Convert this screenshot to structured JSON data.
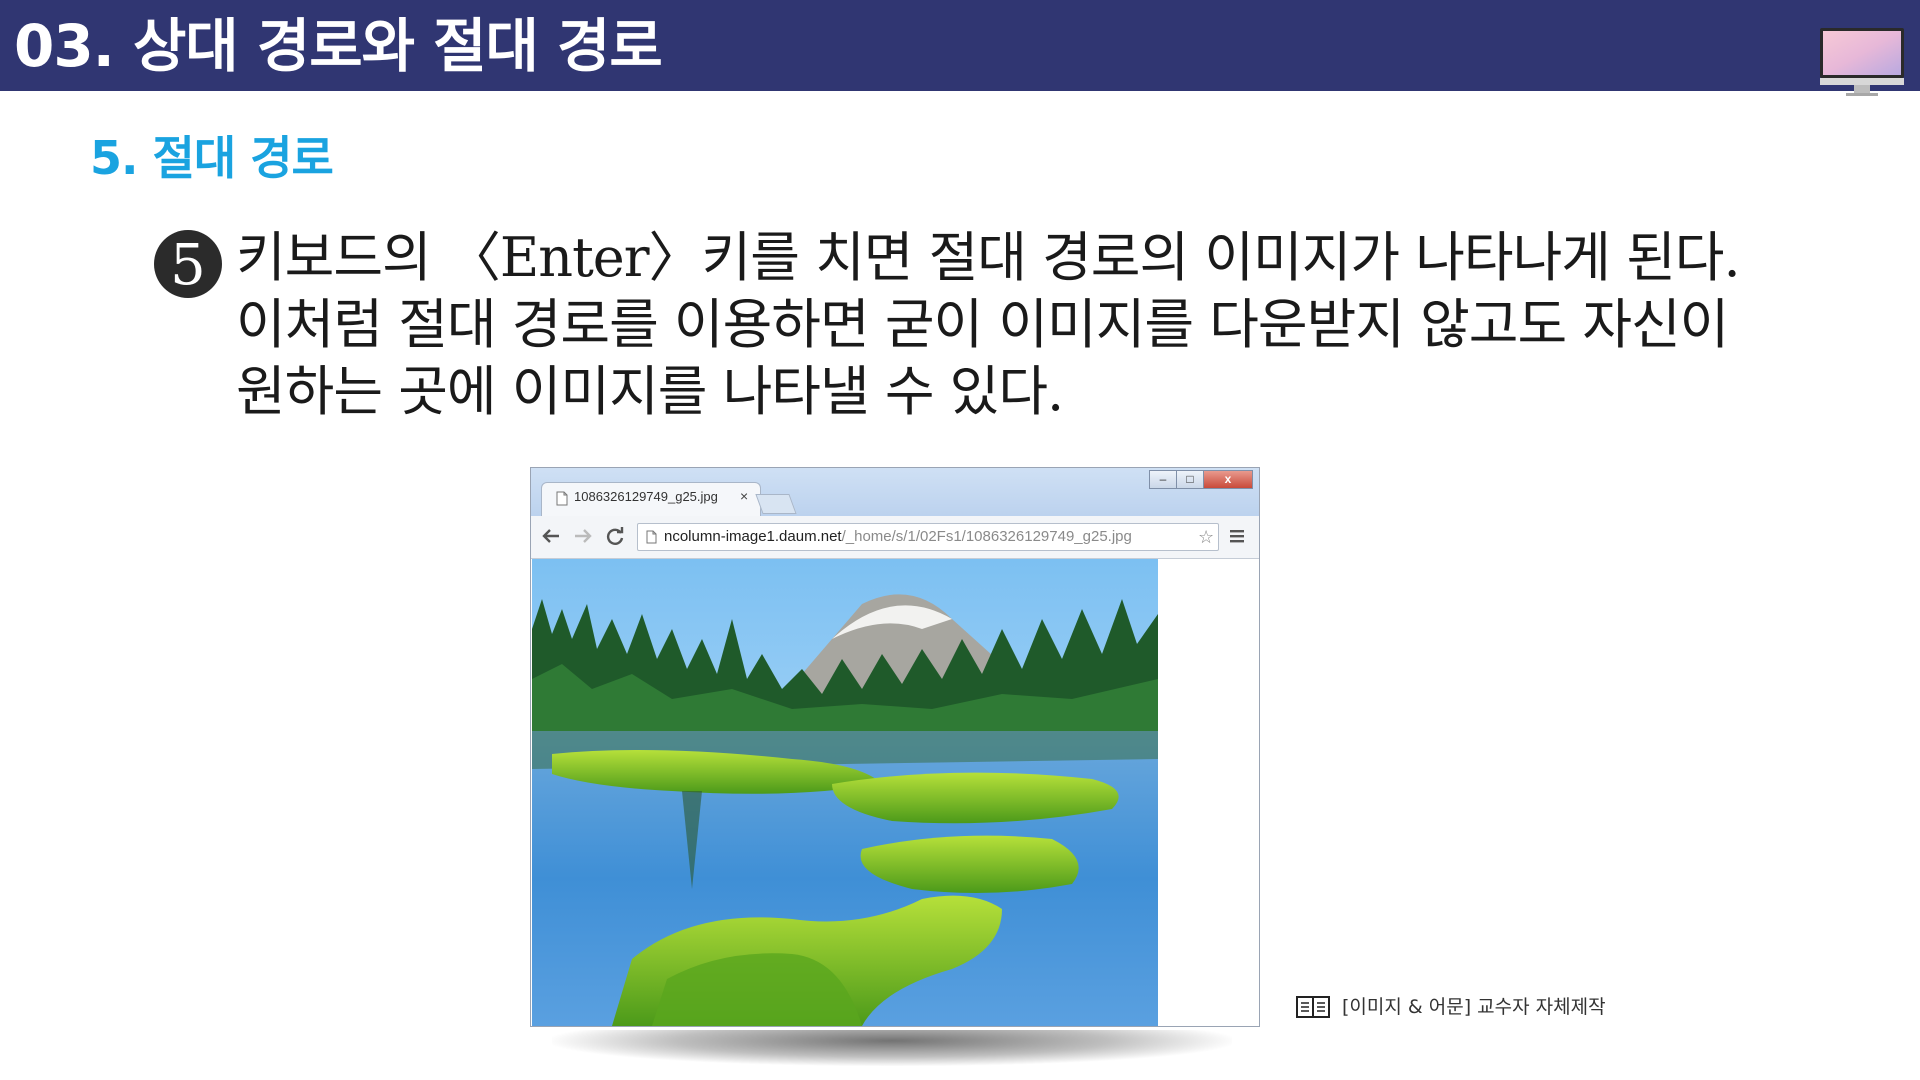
{
  "header": {
    "title": "03. 상대 경로와 절대 경로"
  },
  "section": {
    "heading": "5. 절대 경로"
  },
  "step": {
    "number": "5",
    "lines": [
      "키보드의 〈Enter〉키를 치면 절대 경로의 이미지가 나타나게 된다.",
      "이처럼 절대 경로를 이용하면 굳이 이미지를 다운받지 않고도 자신이",
      "원하는 곳에 이미지를 나타낼 수 있다."
    ]
  },
  "browser": {
    "tab_title": "1086326129749_g25.jpg",
    "tab_close": "×",
    "url_host": "ncolumn-image1.daum.net",
    "url_path": "/_home/s/1/02Fs1/1086326129749_g25.jpg",
    "win_min": "–",
    "win_max": "□",
    "win_close": "x"
  },
  "caption": {
    "text": "[이미지 & 어문] 교수자 자체제작"
  },
  "icons": {
    "monitor": "monitor-icon",
    "page": "page-icon",
    "back": "back-arrow-icon",
    "forward": "forward-arrow-icon",
    "reload": "reload-icon",
    "star": "star-icon",
    "menu": "hamburger-menu-icon",
    "book": "book-icon"
  },
  "colors": {
    "header_bg": "#303672",
    "heading_accent": "#1aa3e0",
    "text": "#1a1a1a"
  }
}
